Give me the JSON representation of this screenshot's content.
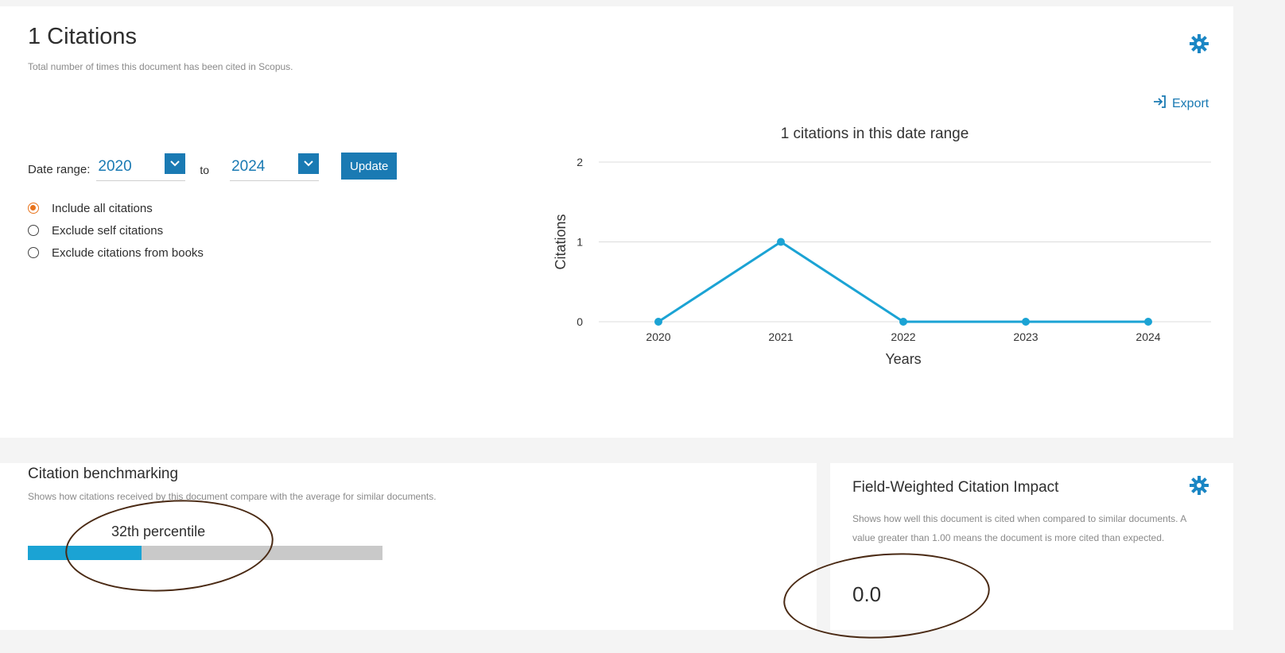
{
  "citations": {
    "title": "1 Citations",
    "subtitle": "Total number of times this document has been cited in Scopus.",
    "export_label": "Export",
    "date_range_label": "Date range:",
    "from_year": "2020",
    "to_label": "to",
    "to_year": "2024",
    "update_label": "Update",
    "options": [
      {
        "label": "Include all citations",
        "selected": true
      },
      {
        "label": "Exclude self citations",
        "selected": false
      },
      {
        "label": "Exclude citations from books",
        "selected": false
      }
    ]
  },
  "chart_data": {
    "type": "line",
    "title": "1 citations in this date range",
    "xlabel": "Years",
    "ylabel": "Citations",
    "x": [
      "2020",
      "2021",
      "2022",
      "2023",
      "2024"
    ],
    "values": [
      0,
      1,
      0,
      0,
      0
    ],
    "yticks": [
      0,
      1,
      2
    ],
    "ylim": [
      0,
      2
    ],
    "grid": true,
    "color": "#1ba3d4"
  },
  "benchmark": {
    "title": "Citation benchmarking",
    "subtitle": "Shows how citations received by this document compare with the average for similar documents.",
    "percentile_label": "32th percentile",
    "percentile": 32,
    "bar_color": "#1ba3d4",
    "track_color": "#c9c9c9"
  },
  "fwci": {
    "title": "Field-Weighted Citation Impact",
    "description": "Shows how well this document is cited when compared to similar documents. A value greater than 1.00 means the document is more cited than expected.",
    "value": "0.0"
  },
  "icons": {
    "gear": "settings-gear-icon",
    "export": "export-arrow-icon",
    "caret": "chevron-down-icon"
  },
  "colors": {
    "accent": "#1a7ab3",
    "radio_selected": "#e8731c"
  }
}
